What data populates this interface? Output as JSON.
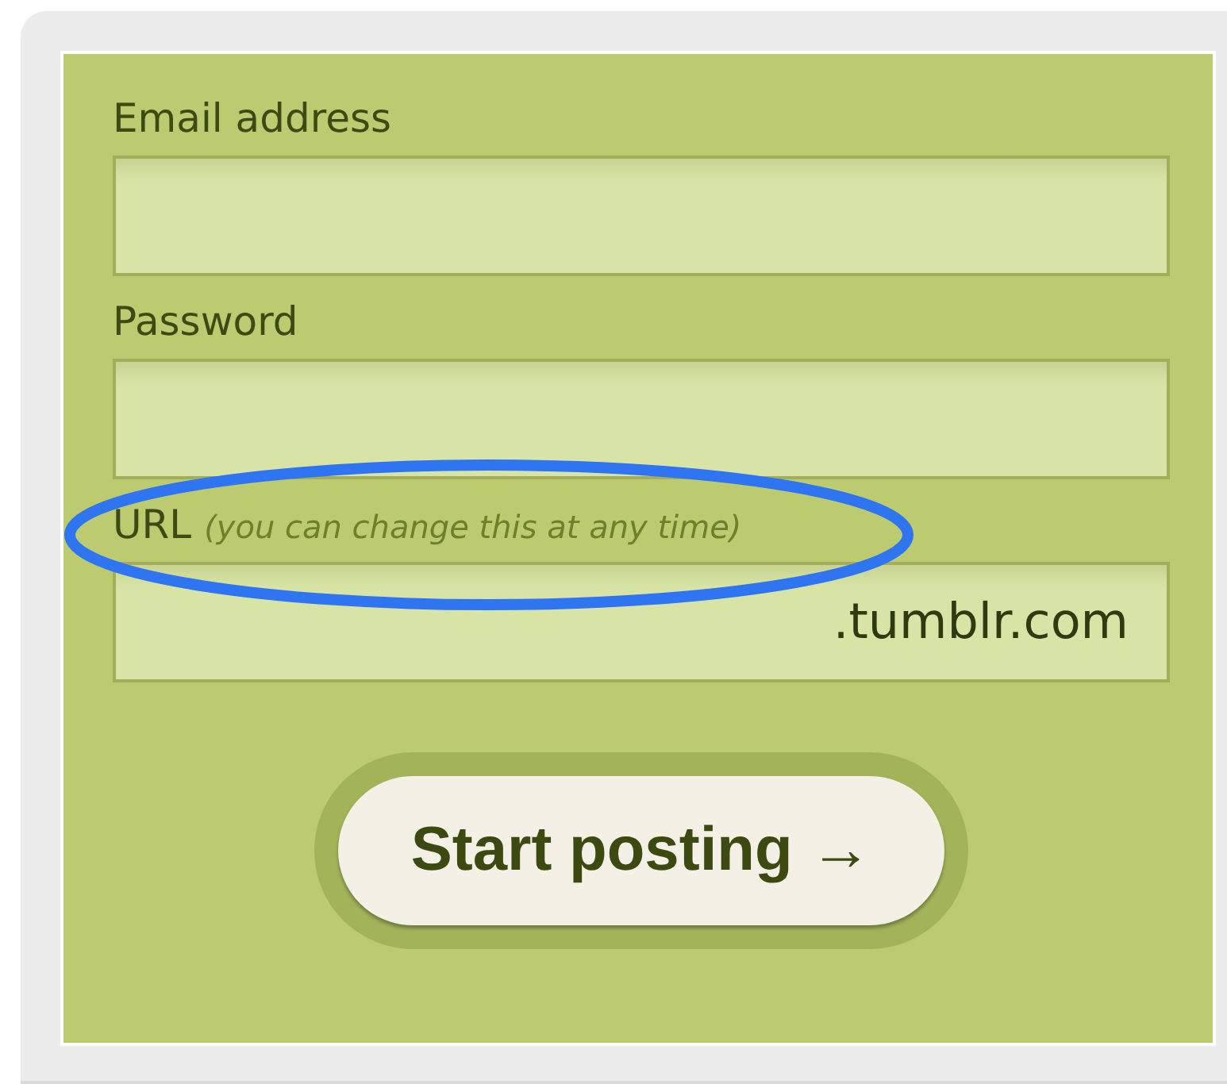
{
  "fields": [
    {
      "label": "Email address",
      "kind": "plain"
    },
    {
      "label": "Password",
      "kind": "plain"
    },
    {
      "label": "URL",
      "hint": "(you can change this at any time)",
      "suffix": ".tumblr.com",
      "kind": "suffixed",
      "highlighted": true
    }
  ],
  "button": {
    "label": "Start posting →"
  }
}
